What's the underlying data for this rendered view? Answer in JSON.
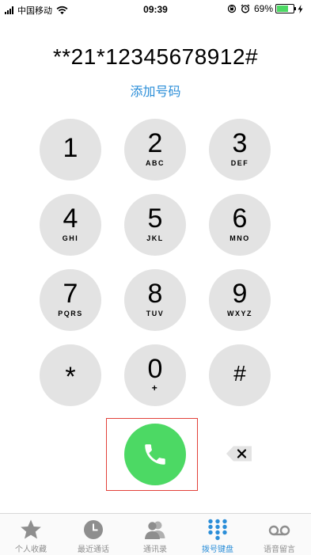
{
  "status_bar": {
    "carrier": "中国移动",
    "time": "09:39",
    "battery_percent": "69%",
    "battery_level": 0.69,
    "battery_color": "#4cd964"
  },
  "dialer": {
    "number": "**21*12345678912#",
    "add_number": "添加号码",
    "accent_color": "#2b8ed8"
  },
  "keypad": {
    "keys": [
      {
        "digit": "1",
        "letters": ""
      },
      {
        "digit": "2",
        "letters": "ABC"
      },
      {
        "digit": "3",
        "letters": "DEF"
      },
      {
        "digit": "4",
        "letters": "GHI"
      },
      {
        "digit": "5",
        "letters": "JKL"
      },
      {
        "digit": "6",
        "letters": "MNO"
      },
      {
        "digit": "7",
        "letters": "PQRS"
      },
      {
        "digit": "8",
        "letters": "TUV"
      },
      {
        "digit": "9",
        "letters": "WXYZ"
      },
      {
        "digit": "*",
        "letters": ""
      },
      {
        "digit": "0",
        "letters": "+"
      },
      {
        "digit": "#",
        "letters": ""
      }
    ],
    "key_color": "#e3e3e3"
  },
  "call": {
    "icon": "phone-icon",
    "color": "#4cd964",
    "highlight_color": "#e2413a"
  },
  "delete": {
    "icon": "backspace-icon"
  },
  "tabs": [
    {
      "label": "个人收藏",
      "icon": "star-icon",
      "active": false
    },
    {
      "label": "最近通话",
      "icon": "clock-icon",
      "active": false
    },
    {
      "label": "通讯录",
      "icon": "contacts-icon",
      "active": false
    },
    {
      "label": "拨号键盘",
      "icon": "keypad-icon",
      "active": true
    },
    {
      "label": "语音留言",
      "icon": "voicemail-icon",
      "active": false
    }
  ]
}
